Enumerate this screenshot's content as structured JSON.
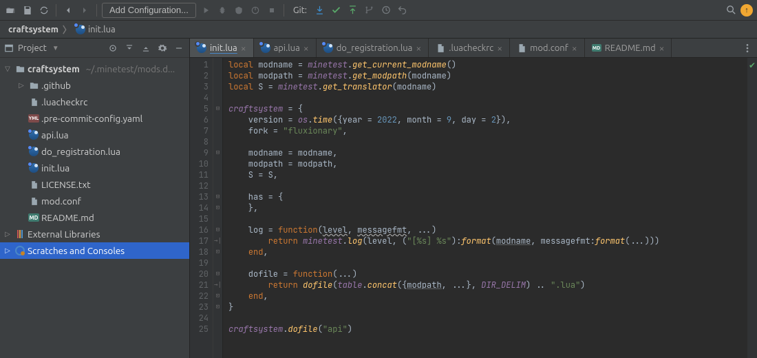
{
  "toolbar": {
    "config_label": "Add Configuration...",
    "git_label": "Git:"
  },
  "breadcrumb": {
    "project": "craftsystem",
    "file": "init.lua"
  },
  "tool": {
    "title": "Project"
  },
  "tree": {
    "root": {
      "name": "craftsystem",
      "hint": "~/.minetest/mods.d..."
    },
    "items": [
      {
        "label": ".github"
      },
      {
        "label": ".luacheckrc"
      },
      {
        "label": ".pre-commit-config.yaml"
      },
      {
        "label": "api.lua"
      },
      {
        "label": "do_registration.lua"
      },
      {
        "label": "init.lua"
      },
      {
        "label": "LICENSE.txt"
      },
      {
        "label": "mod.conf"
      },
      {
        "label": "README.md"
      }
    ],
    "ext_lib": "External Libraries",
    "scratch": "Scratches and Consoles"
  },
  "tabs": [
    {
      "label": "init.lua"
    },
    {
      "label": "api.lua"
    },
    {
      "label": "do_registration.lua"
    },
    {
      "label": ".luacheckrc"
    },
    {
      "label": "mod.conf"
    },
    {
      "label": "README.md"
    }
  ],
  "lines": 25
}
